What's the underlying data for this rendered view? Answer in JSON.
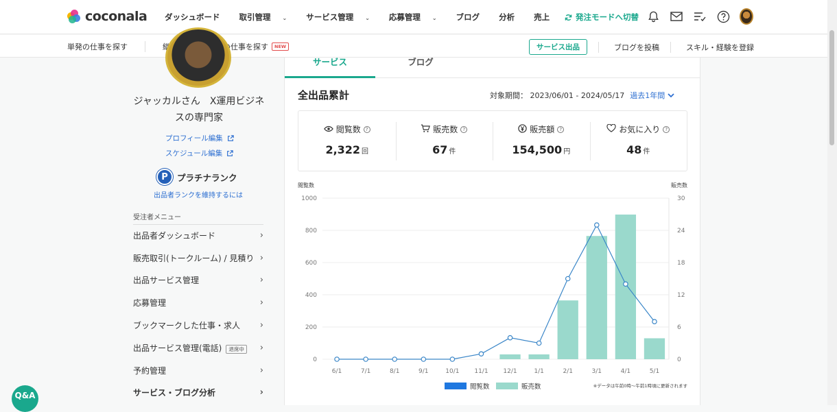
{
  "header": {
    "logo_text": "coconala",
    "nav": [
      {
        "label": "ダッシュボード",
        "caret": false
      },
      {
        "label": "取引管理",
        "caret": true
      },
      {
        "label": "サービス管理",
        "caret": true
      },
      {
        "label": "応募管理",
        "caret": true
      },
      {
        "label": "ブログ",
        "caret": false
      },
      {
        "label": "分析",
        "caret": false
      },
      {
        "label": "売上",
        "caret": false
      }
    ],
    "mode_switch": "発注モードへ切替"
  },
  "subnav": {
    "single_jobs": "単発の仕事を探す",
    "continuous_jobs": "継続（業務委託）の仕事を探す",
    "new_badge": "NEW",
    "post_service": "サービス出品",
    "post_blog": "ブログを投稿",
    "register_skills": "スキル・経験を登録"
  },
  "sidebar": {
    "name": "ジャッカルさん　X運用ビジネスの専門家",
    "edit_profile": "プロフィール編集",
    "edit_schedule": "スケジュール編集",
    "rank_icon_letter": "P",
    "rank": "プラチナランク",
    "rank_help": "出品者ランクを維持するには",
    "menu_heading": "受注者メニュー",
    "menu": [
      {
        "label": "出品者ダッシュボード",
        "tag": "",
        "active": false
      },
      {
        "label": "販売取引(トークルーム) / 見積り",
        "tag": "",
        "active": false
      },
      {
        "label": "出品サービス管理",
        "tag": "",
        "active": false
      },
      {
        "label": "応募管理",
        "tag": "",
        "active": false
      },
      {
        "label": "ブックマークした仕事・求人",
        "tag": "",
        "active": false
      },
      {
        "label": "出品サービス管理(電話)",
        "tag": "退席中",
        "active": false
      },
      {
        "label": "予約管理",
        "tag": "",
        "active": false
      },
      {
        "label": "サービス・ブログ分析",
        "tag": "",
        "active": true
      }
    ],
    "qa_label": "Q&A"
  },
  "main": {
    "tabs": [
      {
        "label": "サービス",
        "active": true
      },
      {
        "label": "ブログ",
        "active": false
      }
    ],
    "title": "全出品累計",
    "period_label": "対象期間：  2023/06/01 - 2024/05/17",
    "period_select": "過去1年間",
    "stats": [
      {
        "icon": "eye-icon",
        "label": "閲覧数",
        "value": "2,322",
        "unit": "回"
      },
      {
        "icon": "cart-icon",
        "label": "販売数",
        "value": "67",
        "unit": "件"
      },
      {
        "icon": "yen-icon",
        "label": "販売額",
        "value": "154,500",
        "unit": "円"
      },
      {
        "icon": "heart-icon",
        "label": "お気に入り",
        "value": "48",
        "unit": "件"
      }
    ]
  },
  "chart_data": {
    "type": "bar",
    "left_axis_label": "閲覧数",
    "right_axis_label": "販売数",
    "categories": [
      "6/1",
      "7/1",
      "8/1",
      "9/1",
      "10/1",
      "11/1",
      "12/1",
      "1/1",
      "2/1",
      "3/1",
      "4/1",
      "5/1"
    ],
    "left_ticks": [
      0,
      200,
      400,
      600,
      800,
      1000
    ],
    "right_ticks": [
      0,
      6,
      12,
      18,
      24,
      30
    ],
    "ylim_left": [
      0,
      1000
    ],
    "ylim_right": [
      0,
      30
    ],
    "series": [
      {
        "name": "閲覧数",
        "kind": "bar",
        "axis": "left",
        "color": "#9ad9cc",
        "values": [
          0,
          0,
          0,
          0,
          0,
          0,
          30,
          30,
          365,
          765,
          898,
          130
        ]
      },
      {
        "name": "販売数",
        "kind": "line",
        "axis": "right",
        "color": "#3a86c8",
        "values": [
          0,
          0,
          0,
          0,
          0,
          1,
          4,
          3,
          15,
          25,
          14,
          7
        ]
      }
    ],
    "legend": [
      {
        "label": "閲覧数",
        "color": "#1f78e0"
      },
      {
        "label": "販売数",
        "color": "#9ad9cc"
      }
    ],
    "note": "※データは午前0時〜午前1時頃に更新されます",
    "grid": true
  },
  "colors": {
    "brand": "#1aa88d",
    "link": "#2d6fd1"
  }
}
